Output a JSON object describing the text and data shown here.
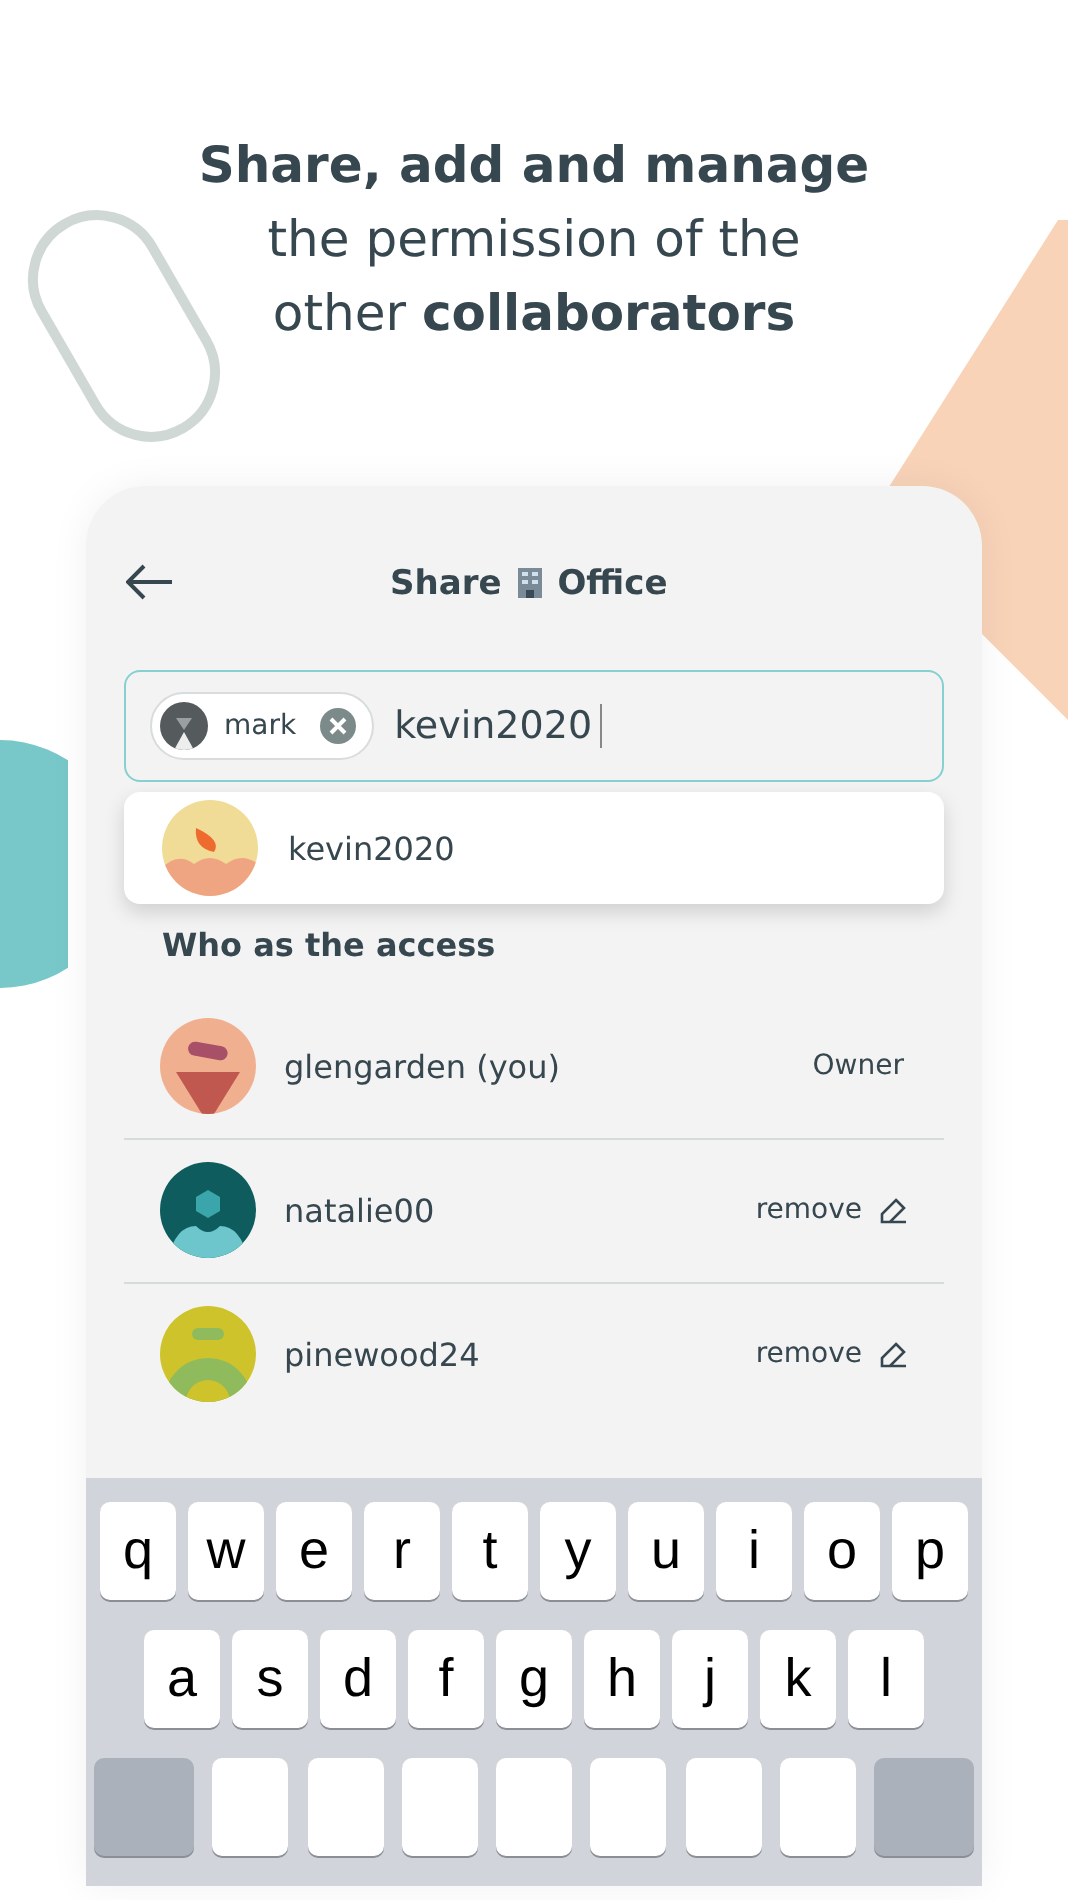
{
  "headline": "**Share, add and manage** the permission of the other **collaborators**",
  "header": {
    "title_before": "Share",
    "title_after": "Office"
  },
  "recipient_field": {
    "chips": [
      {
        "label": "mark",
        "avatar": {
          "kind": "grey"
        }
      }
    ],
    "value": "kevin2020"
  },
  "suggestions": [
    {
      "name": "kevin2020",
      "avatar": {
        "kind": "sun"
      }
    }
  ],
  "access_heading": "Who as the access",
  "members": [
    {
      "name": "glengarden (you)",
      "kind": "owner",
      "role": "Owner",
      "avatar": {
        "kind": "peach"
      }
    },
    {
      "name": "natalie00",
      "kind": "removable",
      "action": "remove",
      "avatar": {
        "kind": "teal"
      }
    },
    {
      "name": "pinewood24",
      "kind": "removable",
      "action": "remove",
      "avatar": {
        "kind": "olive"
      }
    }
  ],
  "keyboard": {
    "rows": [
      [
        "q",
        "w",
        "e",
        "r",
        "t",
        "y",
        "u",
        "i",
        "o",
        "p"
      ],
      [
        "a",
        "s",
        "d",
        "f",
        "g",
        "h",
        "j",
        "k",
        "l"
      ]
    ]
  }
}
